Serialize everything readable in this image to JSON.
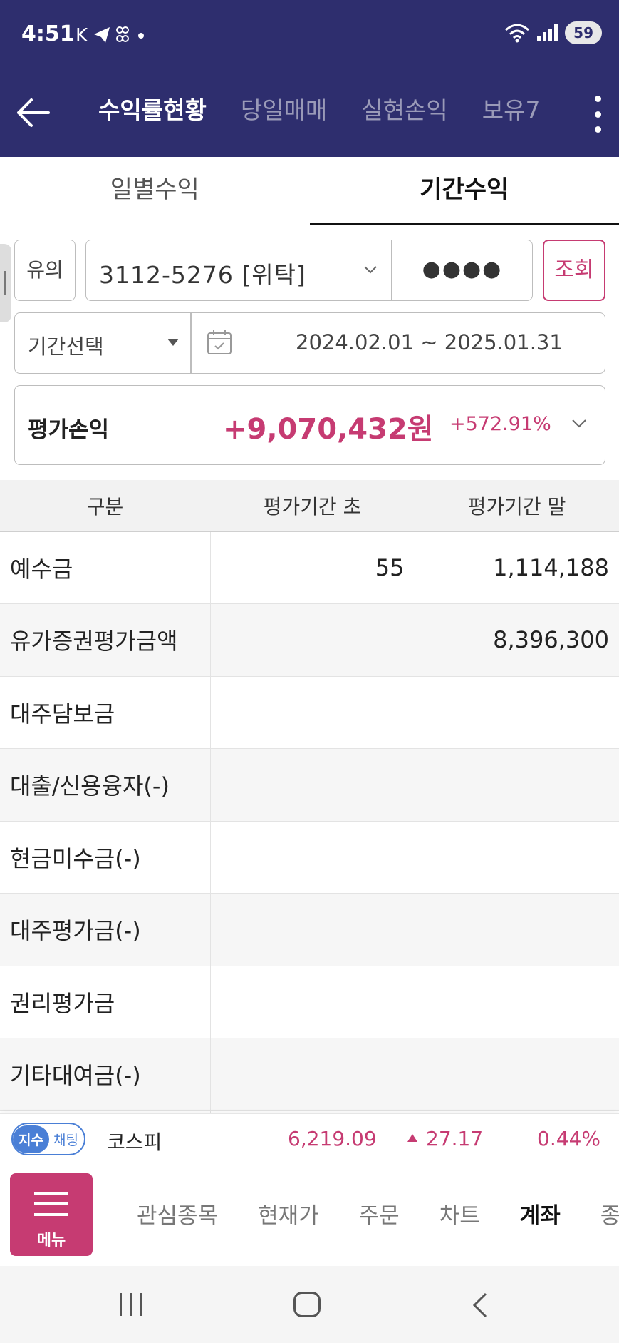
{
  "status_bar": {
    "time": "4:51",
    "battery": "59"
  },
  "header": {
    "tabs": [
      {
        "label": "수익률현황",
        "active": true
      },
      {
        "label": "당일매매",
        "active": false
      },
      {
        "label": "실현손익",
        "active": false
      },
      {
        "label": "보유7",
        "active": false
      }
    ]
  },
  "subtabs": [
    {
      "label": "일별수익",
      "active": false
    },
    {
      "label": "기간수익",
      "active": true
    }
  ],
  "filters": {
    "notice_label": "유의",
    "account": "3112-5276 [위탁]",
    "password_mask": "●●●●",
    "query_label": "조회",
    "period_select": "기간선택",
    "date_range": "2024.02.01 ~ 2025.01.31"
  },
  "summary": {
    "label": "평가손익",
    "value": "+9,070,432원",
    "rate": "+572.91%"
  },
  "table": {
    "headers": [
      "구분",
      "평가기간 초",
      "평가기간 말"
    ],
    "rows": [
      {
        "label": "예수금",
        "start": "55",
        "end": "1,114,188"
      },
      {
        "label": "유가증권평가금액",
        "start": "",
        "end": "8,396,300"
      },
      {
        "label": "대주담보금",
        "start": "",
        "end": ""
      },
      {
        "label": "대출/신용융자(-)",
        "start": "",
        "end": ""
      },
      {
        "label": "현금미수금(-)",
        "start": "",
        "end": ""
      },
      {
        "label": "대주평가금(-)",
        "start": "",
        "end": ""
      },
      {
        "label": "권리평가금",
        "start": "",
        "end": ""
      },
      {
        "label": "기타대여금(-)",
        "start": "",
        "end": ""
      },
      {
        "label": "",
        "start": "",
        "end": ""
      }
    ]
  },
  "ticker": {
    "toggle_a": "지수",
    "toggle_b": "채팅",
    "name": "코스피",
    "value": "6,219.09",
    "change": "27.17",
    "percent": "0.44%"
  },
  "bottom_menu": {
    "menu_label": "메뉴",
    "items": [
      "관심종목",
      "현재가",
      "주문",
      "차트",
      "계좌",
      "종"
    ]
  },
  "colors": {
    "header_bg": "#2e2e6e",
    "accent": "#c63b72",
    "pill_blue": "#4a7fd6"
  }
}
